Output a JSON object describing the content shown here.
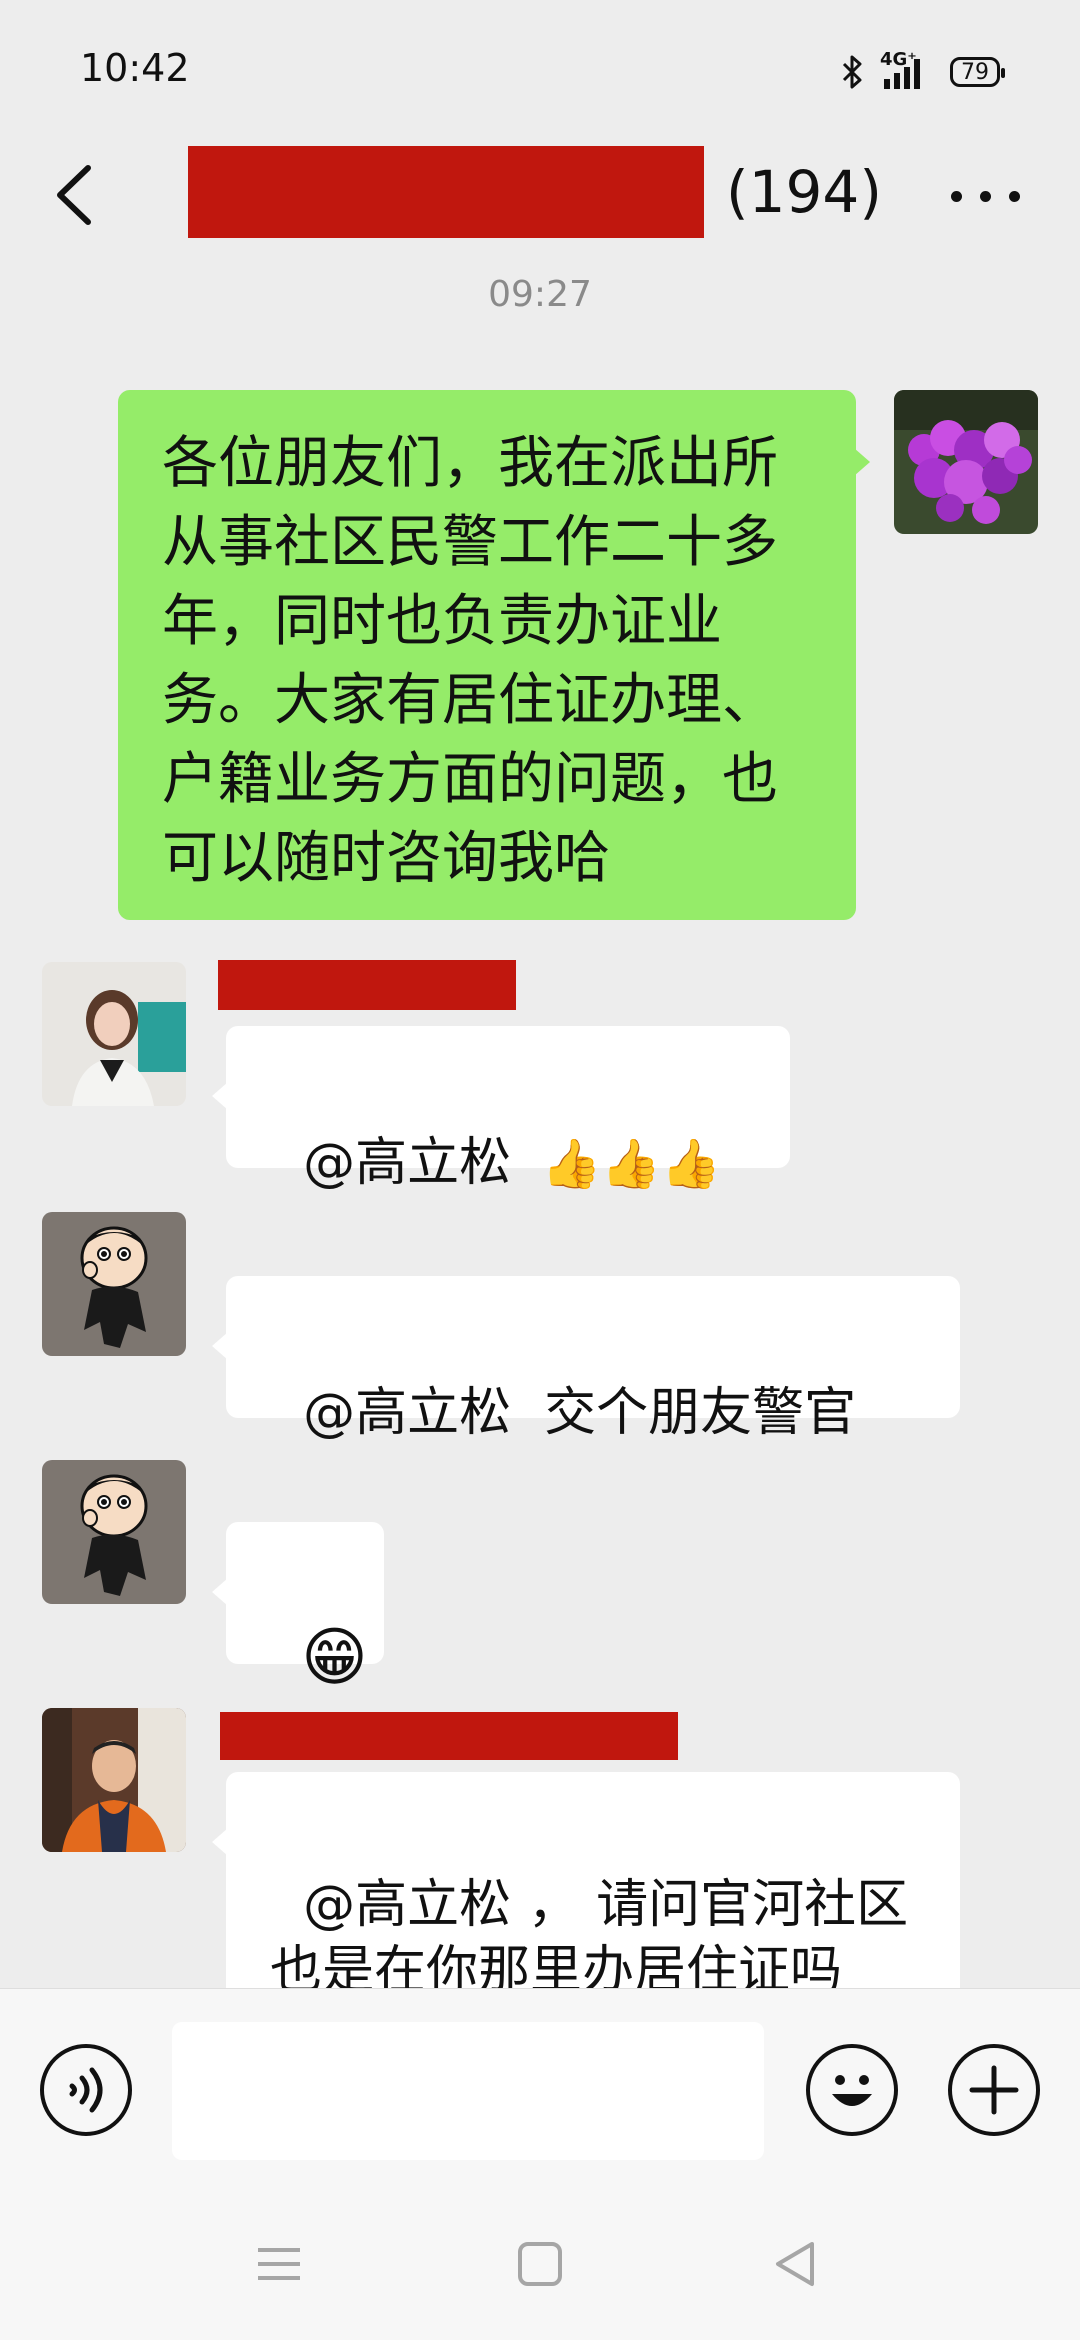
{
  "status_bar": {
    "time": "10:42",
    "network": "4G⁺",
    "battery": "79"
  },
  "header": {
    "member_count": "(194)"
  },
  "chat": {
    "timestamp": "09:27",
    "messages": [
      {
        "side": "right",
        "text": "各位朋友们，我在派出所从事社区民警工作二十多年，同时也负责办证业务。大家有居住证办理、户籍业务方面的问题，也可以随时咨询我哈"
      },
      {
        "side": "left",
        "text": "@高立松 ",
        "emoji": "👍👍👍"
      },
      {
        "side": "left",
        "text": "@高立松  交个朋友警官"
      },
      {
        "side": "left",
        "emoji": "😁"
      },
      {
        "side": "left",
        "text": "@高立松 ， 请问官河社区也是在你那里办居住证吗"
      }
    ]
  },
  "input_bar": {
    "voice_icon": "voice-icon",
    "emoji_icon": "smiley-icon",
    "plus_icon": "plus-icon"
  },
  "colors": {
    "self_bubble": "#95ec69",
    "redaction": "#c0170e",
    "background": "#ededed"
  }
}
